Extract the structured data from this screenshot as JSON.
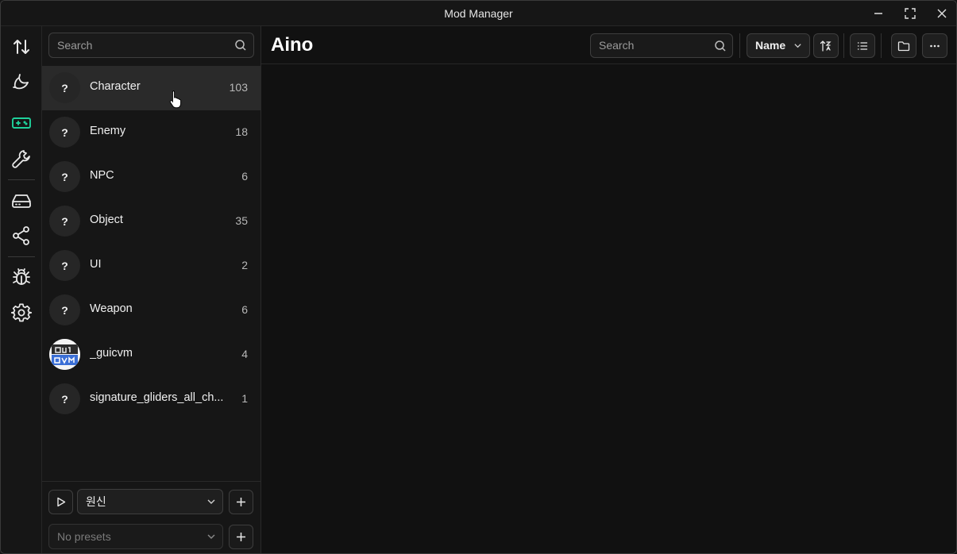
{
  "window": {
    "title": "Mod Manager"
  },
  "rail": {
    "items": [
      {
        "icon": "sort-arrows-icon"
      },
      {
        "icon": "banana-icon"
      },
      {
        "icon": "gamepad-icon",
        "active": true
      },
      {
        "icon": "wrench-icon"
      },
      {
        "icon": "drive-icon"
      },
      {
        "icon": "share-icon"
      },
      {
        "icon": "bug-icon"
      },
      {
        "icon": "gear-icon"
      }
    ],
    "accent_color": "#1fd19b"
  },
  "categories": {
    "search_placeholder": "Search",
    "items": [
      {
        "name": "Character",
        "count": "103",
        "avatar": "?",
        "active": true
      },
      {
        "name": "Enemy",
        "count": "18",
        "avatar": "?"
      },
      {
        "name": "NPC",
        "count": "6",
        "avatar": "?"
      },
      {
        "name": "Object",
        "count": "35",
        "avatar": "?"
      },
      {
        "name": "UI",
        "count": "2",
        "avatar": "?"
      },
      {
        "name": "Weapon",
        "count": "6",
        "avatar": "?"
      },
      {
        "name": "_guicvm",
        "count": "4",
        "avatar": "image"
      },
      {
        "name": "signature_gliders_all_ch...",
        "count": "1",
        "avatar": "?"
      }
    ]
  },
  "footer": {
    "game_select_value": "원신",
    "presets_placeholder": "No presets"
  },
  "main": {
    "title": "Aino",
    "search_placeholder": "Search",
    "sort_value": "Name"
  }
}
